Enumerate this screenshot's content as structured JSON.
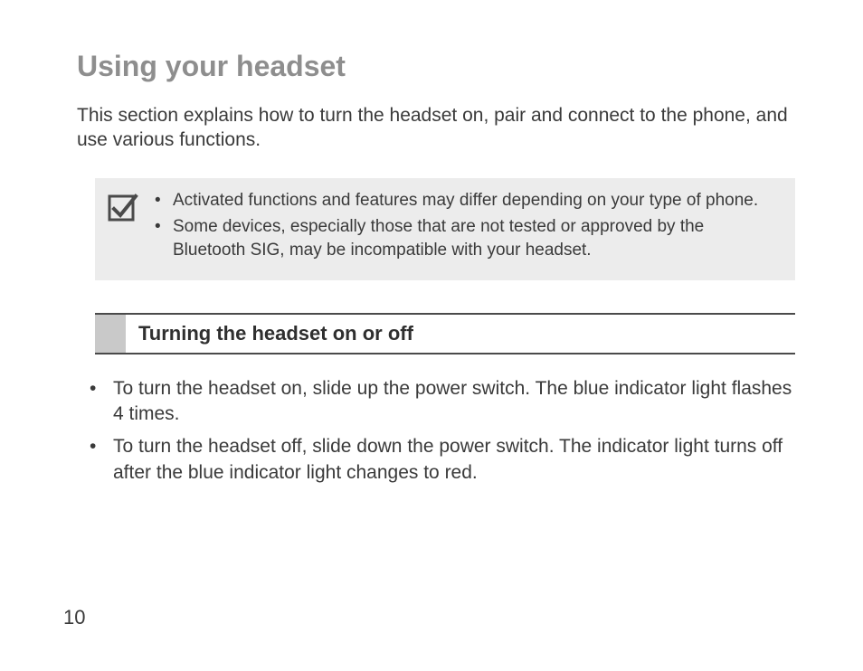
{
  "title": "Using your headset",
  "intro": "This section explains how to turn the headset on, pair and connect to the phone, and use various functions.",
  "note": {
    "items": [
      "Activated functions and features may differ depending on your type of phone.",
      "Some devices, especially those that are not tested or approved by the Bluetooth SIG, may be incompatible with your headset."
    ]
  },
  "section": {
    "heading": "Turning the headset on or off",
    "items": [
      "To turn the headset on, slide up the power switch. The blue indicator light flashes 4 times.",
      "To turn the headset off, slide down the power switch. The indicator light turns off after the blue indicator light changes to red."
    ]
  },
  "page_number": "10"
}
